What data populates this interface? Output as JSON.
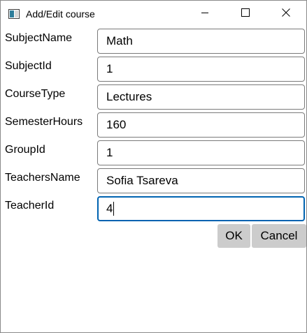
{
  "window": {
    "title": "Add/Edit course",
    "icons": {
      "app": "window-app-icon",
      "minimize": "minimize-icon",
      "maximize": "maximize-icon",
      "close": "close-icon"
    }
  },
  "form": {
    "fields": [
      {
        "label": "SubjectName",
        "value": "Math"
      },
      {
        "label": "SubjectId",
        "value": "1"
      },
      {
        "label": "CourseType",
        "value": "Lectures"
      },
      {
        "label": "SemesterHours",
        "value": "160"
      },
      {
        "label": "GroupId",
        "value": "1"
      },
      {
        "label": "TeachersName",
        "value": "Sofia Tsareva"
      },
      {
        "label": "TeacherId",
        "value": "4"
      }
    ]
  },
  "buttons": {
    "ok": "OK",
    "cancel": "Cancel"
  },
  "colors": {
    "focus_border": "#0063b1",
    "button_bg": "#cccccc",
    "field_border": "#7a7a7a"
  }
}
